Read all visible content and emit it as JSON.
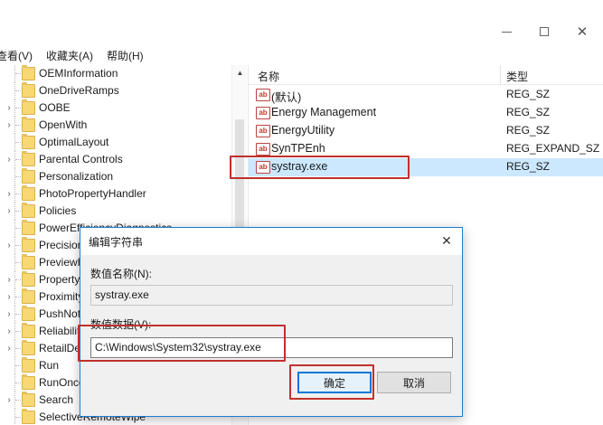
{
  "menu": {
    "items": [
      "查看(V)",
      "收藏夹(A)",
      "帮助(H)"
    ]
  },
  "tree": {
    "items": [
      {
        "label": "OEMInformation",
        "expandable": false
      },
      {
        "label": "OneDriveRamps",
        "expandable": false
      },
      {
        "label": "OOBE",
        "expandable": true
      },
      {
        "label": "OpenWith",
        "expandable": true
      },
      {
        "label": "OptimalLayout",
        "expandable": false
      },
      {
        "label": "Parental Controls",
        "expandable": true
      },
      {
        "label": "Personalization",
        "expandable": false
      },
      {
        "label": "PhotoPropertyHandler",
        "expandable": true
      },
      {
        "label": "Policies",
        "expandable": true
      },
      {
        "label": "PowerEfficiencyDiagnostics",
        "expandable": false
      },
      {
        "label": "PrecisionTouchPad",
        "expandable": true
      },
      {
        "label": "PreviewHandlers",
        "expandable": false
      },
      {
        "label": "PropertySystem",
        "expandable": true
      },
      {
        "label": "Proximity",
        "expandable": true
      },
      {
        "label": "PushNotifications",
        "expandable": true
      },
      {
        "label": "Reliability",
        "expandable": true
      },
      {
        "label": "RetailDemo",
        "expandable": true
      },
      {
        "label": "Run",
        "expandable": false,
        "selected": true
      },
      {
        "label": "RunOnce",
        "expandable": false
      },
      {
        "label": "Search",
        "expandable": true
      },
      {
        "label": "SelectiveRemoteWipe",
        "expandable": false
      }
    ]
  },
  "list": {
    "columns": {
      "name": "名称",
      "type": "类型"
    },
    "rows": [
      {
        "name": "(默认)",
        "type": "REG_SZ",
        "icon": "ab-string-icon"
      },
      {
        "name": "Energy Management",
        "type": "REG_SZ",
        "icon": "ab-string-icon"
      },
      {
        "name": "EnergyUtility",
        "type": "REG_SZ",
        "icon": "ab-string-icon"
      },
      {
        "name": "SynTPEnh",
        "type": "REG_EXPAND_SZ",
        "icon": "ab-string-icon"
      },
      {
        "name": "systray.exe",
        "type": "REG_SZ",
        "icon": "ab-string-icon",
        "selected": true
      }
    ]
  },
  "dialog": {
    "title": "编辑字符串",
    "name_label": "数值名称(N):",
    "name_value": "systray.exe",
    "data_label": "数值数据(V):",
    "data_value": "C:\\Windows\\System32\\systray.exe",
    "ok_label": "确定",
    "cancel_label": "取消"
  },
  "colors": {
    "accent": "#0078d7",
    "highlight": "#c0312c",
    "selection": "#cce8ff"
  }
}
